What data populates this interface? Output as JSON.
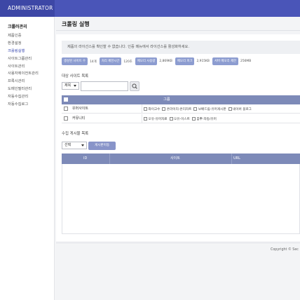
{
  "app": {
    "brand": "ADMINISTRATOR"
  },
  "sidebar": {
    "title": "크롤러관리",
    "items": [
      {
        "label": "제품인증"
      },
      {
        "label": "환경설정"
      },
      {
        "label": "크롤링실행"
      },
      {
        "label": "사이트그룹관리"
      },
      {
        "label": "사이트관리"
      },
      {
        "label": "사용자에이전트관리"
      },
      {
        "label": "프록시관리"
      },
      {
        "label": "도메인필터관리"
      },
      {
        "label": "자동수집관리"
      },
      {
        "label": "자동수집로그"
      }
    ],
    "active_index": 2
  },
  "page": {
    "title": "크롤링 실행",
    "notice": "제품의 라이선스를 확인할 수 없습니다. 인증 메뉴에서 라이선스를 활성화하세요."
  },
  "stats": [
    {
      "label": "생성된 사이트 수",
      "value": "14개"
    },
    {
      "label": "처리 제한시간",
      "value": "120초"
    },
    {
      "label": "메모리 사용량",
      "value": "2,869KB"
    },
    {
      "label": "메모리 피크",
      "value": "2,915KB"
    },
    {
      "label": "서버 메모리 제한",
      "value": "256MB"
    }
  ],
  "targets": {
    "section_title": "대상 사이트 목록",
    "filter_select": "제목",
    "search_value": "",
    "header_label": "그룹",
    "rows": [
      {
        "group": "유머사이트",
        "sites": [
          "와이고수",
          "온라이리-온리차트",
          "보배드림-유머게시판",
          "네이버 블로그"
        ]
      },
      {
        "group": "커뮤니티",
        "sites": [
          "오유-유머자료",
          "오유-이스트",
          "뽐뿌-자동/유머"
        ]
      }
    ]
  },
  "collected": {
    "section_title": "수집 게시물 목록",
    "select_value": "선택",
    "button_label": "게시판이동",
    "columns": [
      "ID",
      "사이트",
      "URL"
    ]
  },
  "footer": {
    "copyright": "Copyright © Sec"
  },
  "colors": {
    "brand_bar": "#4a55b8",
    "grid_header": "#7d8ab8",
    "stat_label": "#8c9cd0"
  }
}
